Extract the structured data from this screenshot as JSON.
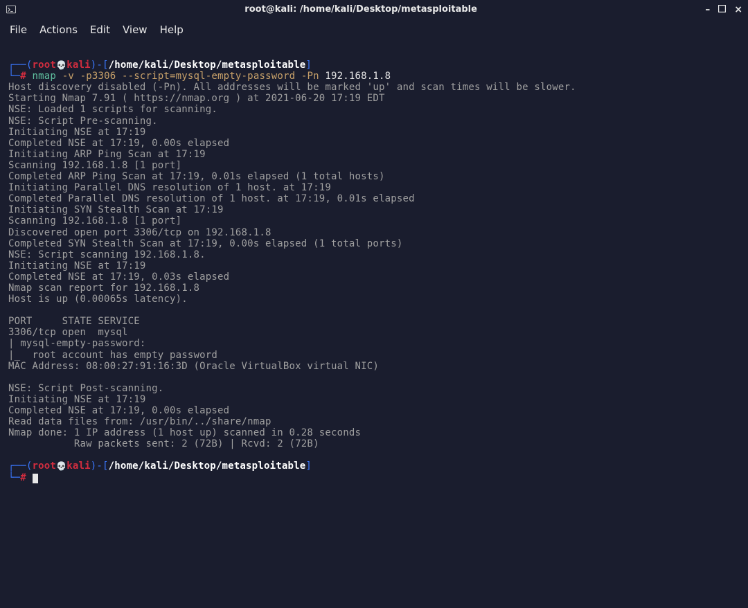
{
  "titlebar": {
    "title": "root@kali: /home/kali/Desktop/metasploitable"
  },
  "menubar": {
    "file": "File",
    "actions": "Actions",
    "edit": "Edit",
    "view": "View",
    "help": "Help"
  },
  "prompt1": {
    "corner_top": "┌──(",
    "user": "root",
    "skull": "💀",
    "host": "kali",
    "close_paren": ")-[",
    "path": "/home/kali/Desktop/metasploitable",
    "end": "]",
    "corner_bottom": "└─",
    "hash": "#",
    "cmd_bin": " nmap",
    "cmd_args_a": " -v -p3306 ",
    "cmd_script": "--script=mysql-empty-password",
    "cmd_args_b": " -Pn",
    "cmd_target": " 192.168.1.8"
  },
  "out": {
    "l1": "Host discovery disabled (-Pn). All addresses will be marked 'up' and scan times will be slower.",
    "l2": "Starting Nmap 7.91 ( https://nmap.org ) at 2021-06-20 17:19 EDT",
    "l3": "NSE: Loaded 1 scripts for scanning.",
    "l4": "NSE: Script Pre-scanning.",
    "l5": "Initiating NSE at 17:19",
    "l6": "Completed NSE at 17:19, 0.00s elapsed",
    "l7": "Initiating ARP Ping Scan at 17:19",
    "l8": "Scanning 192.168.1.8 [1 port]",
    "l9": "Completed ARP Ping Scan at 17:19, 0.01s elapsed (1 total hosts)",
    "l10": "Initiating Parallel DNS resolution of 1 host. at 17:19",
    "l11": "Completed Parallel DNS resolution of 1 host. at 17:19, 0.01s elapsed",
    "l12": "Initiating SYN Stealth Scan at 17:19",
    "l13": "Scanning 192.168.1.8 [1 port]",
    "l14": "Discovered open port 3306/tcp on 192.168.1.8",
    "l15": "Completed SYN Stealth Scan at 17:19, 0.00s elapsed (1 total ports)",
    "l16": "NSE: Script scanning 192.168.1.8.",
    "l17": "Initiating NSE at 17:19",
    "l18": "Completed NSE at 17:19, 0.03s elapsed",
    "l19": "Nmap scan report for 192.168.1.8",
    "l20": "Host is up (0.00065s latency).",
    "l21": "",
    "l22": "PORT     STATE SERVICE",
    "l23": "3306/tcp open  mysql",
    "l24": "| mysql-empty-password: ",
    "l25": "|_  root account has empty password",
    "l26": "MAC Address: 08:00:27:91:16:3D (Oracle VirtualBox virtual NIC)",
    "l27": "",
    "l28": "NSE: Script Post-scanning.",
    "l29": "Initiating NSE at 17:19",
    "l30": "Completed NSE at 17:19, 0.00s elapsed",
    "l31": "Read data files from: /usr/bin/../share/nmap",
    "l32": "Nmap done: 1 IP address (1 host up) scanned in 0.28 seconds",
    "l33": "           Raw packets sent: 2 (72B) | Rcvd: 2 (72B)"
  },
  "prompt2": {
    "corner_top": "┌──(",
    "user": "root",
    "skull": "💀",
    "host": "kali",
    "close_paren": ")-[",
    "path": "/home/kali/Desktop/metasploitable",
    "end": "]",
    "corner_bottom": "└─",
    "hash": "#"
  }
}
